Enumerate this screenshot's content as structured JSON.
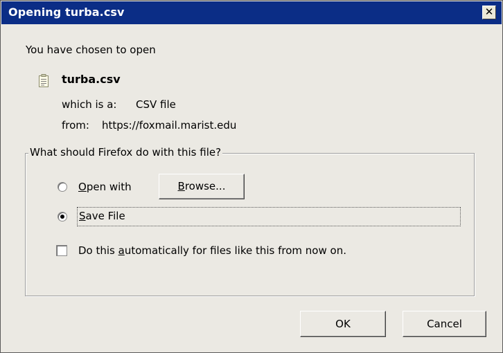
{
  "window": {
    "title": "Opening turba.csv",
    "close_glyph": "✕"
  },
  "intro_text": "You have chosen to open",
  "file": {
    "icon": "text-file-icon",
    "name": "turba.csv",
    "which_is_label": "which is a:",
    "which_is_value": "CSV file",
    "from_label": "from:",
    "from_value": "https://foxmail.marist.edu"
  },
  "action_group": {
    "legend": "What should Firefox do with this file?",
    "open_with": {
      "mnemonic": "O",
      "rest": "pen with",
      "selected": false
    },
    "browse_button": {
      "mnemonic": "B",
      "rest": "rowse..."
    },
    "save_file": {
      "mnemonic": "S",
      "rest": "ave File",
      "selected": true
    },
    "auto_checkbox": {
      "before": "Do this ",
      "mnemonic": "a",
      "after": "utomatically for files like this from now on.",
      "checked": false
    }
  },
  "buttons": {
    "ok": "OK",
    "cancel": "Cancel"
  },
  "colors": {
    "titlebar": "#0b2d86",
    "dialog_bg": "#ebe9e3"
  }
}
